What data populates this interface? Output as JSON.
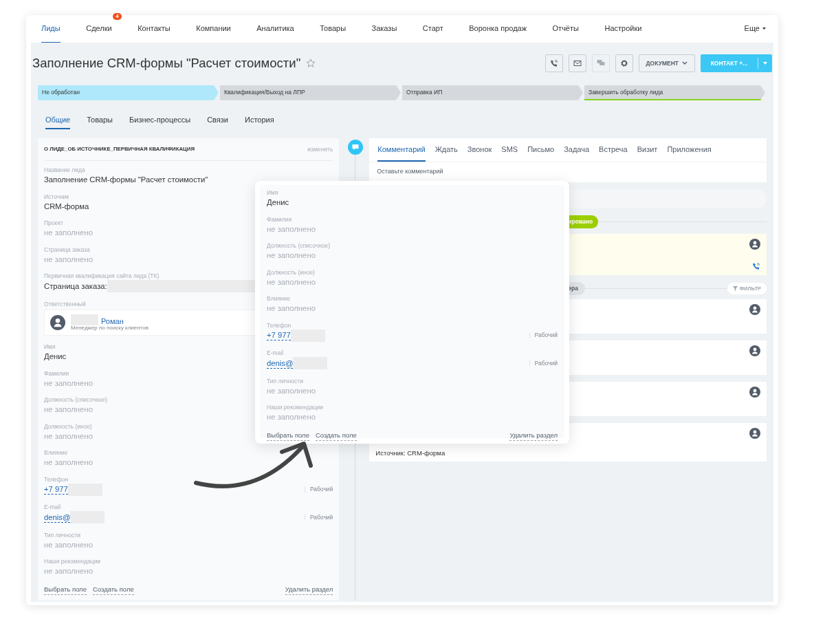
{
  "nav": {
    "items": [
      {
        "label": "Лиды",
        "selected": true
      },
      {
        "label": "Сделки",
        "selected": false,
        "badge": "4"
      },
      {
        "label": "Контакты",
        "selected": false
      },
      {
        "label": "Компании",
        "selected": false
      },
      {
        "label": "Аналитика",
        "selected": false
      },
      {
        "label": "Товары",
        "selected": false
      },
      {
        "label": "Заказы",
        "selected": false
      },
      {
        "label": "Старт",
        "selected": false
      },
      {
        "label": "Воронка продаж",
        "selected": false
      },
      {
        "label": "Отчёты",
        "selected": false
      },
      {
        "label": "Настройки",
        "selected": false
      }
    ],
    "more": "Еще"
  },
  "header": {
    "title": "Заполнение CRM-формы \"Расчет стоимости\"",
    "starred": false,
    "icon_buttons": [
      {
        "kind": "phone",
        "disabled": false
      },
      {
        "kind": "mail",
        "disabled": false
      },
      {
        "kind": "chat",
        "disabled": true
      },
      {
        "kind": "settings",
        "disabled": false
      }
    ],
    "document_button": "ДОКУМЕНТ",
    "primary_button": "КОНТАКТ +..."
  },
  "stages": [
    {
      "label": "Не обработан",
      "selected": true,
      "kind": "step"
    },
    {
      "label": "Квалификация/Выход на ЛПР",
      "selected": false,
      "kind": "step"
    },
    {
      "label": "Отправка ИП",
      "selected": false,
      "kind": "step"
    },
    {
      "label": "Завершить обработку лида",
      "selected": false,
      "kind": "final"
    }
  ],
  "tabs": [
    {
      "label": "Общие",
      "selected": true
    },
    {
      "label": "Товары",
      "selected": false
    },
    {
      "label": "Бизнес-процессы",
      "selected": false
    },
    {
      "label": "Связи",
      "selected": false
    },
    {
      "label": "История",
      "selected": false
    }
  ],
  "section": {
    "title": "О ЛИДЕ_ОБ ИСТОЧНИКЕ_ПЕРВИЧНАЯ КВАЛИФИКАЦИЯ",
    "edit_link": "изменить",
    "fields": [
      {
        "kind": "text",
        "label": "Название лида",
        "value": "Заполнение CRM-формы \"Расчет стоимости\""
      },
      {
        "kind": "text",
        "label": "Источник",
        "value": "CRM-форма"
      },
      {
        "kind": "empty",
        "label": "Проект",
        "value": "не заполнено"
      },
      {
        "kind": "empty",
        "label": "Страница заказа",
        "value": "не заполнено"
      },
      {
        "kind": "masked",
        "label": "Первичная квалификация сайта лида (ТК)",
        "value": "Страница заказа:"
      },
      {
        "kind": "person",
        "label": "Ответственный",
        "value": "Роман",
        "role": "Менеджер по поиску клиентов"
      },
      {
        "kind": "text",
        "label": "Имя",
        "value": "Денис"
      },
      {
        "kind": "empty",
        "label": "Фамилия",
        "value": "не заполнено"
      },
      {
        "kind": "empty",
        "label": "Должность (списочное)",
        "value": "не заполнено"
      },
      {
        "kind": "empty",
        "label": "Должность (иное)",
        "value": "не заполнено"
      },
      {
        "kind": "empty",
        "label": "Влияние",
        "value": "не заполнено"
      },
      {
        "kind": "contact",
        "label": "Телефон",
        "value": "+7 977",
        "type": "Рабочий"
      },
      {
        "kind": "contact",
        "label": "E-mail",
        "value": "denis@",
        "type": "Рабочий"
      },
      {
        "kind": "empty",
        "label": "Тип личности",
        "value": "не заполнено"
      },
      {
        "kind": "empty",
        "label": "Наши рекомендации",
        "value": "не заполнено"
      }
    ],
    "footer_links": [
      "Выбрать поле",
      "Создать поле"
    ],
    "delete_link": "Удалить раздел"
  },
  "activity": {
    "tabs": [
      {
        "label": "Комментарий",
        "selected": true
      },
      {
        "label": "Ждать",
        "selected": false
      },
      {
        "label": "Звонок",
        "selected": false
      },
      {
        "label": "SMS",
        "selected": false
      },
      {
        "label": "Письмо",
        "selected": false
      },
      {
        "label": "Задача",
        "selected": false
      },
      {
        "label": "Встреча",
        "selected": false
      },
      {
        "label": "Визит",
        "selected": false
      },
      {
        "label": "Приложения",
        "selected": false
      }
    ],
    "placeholder": "Оставьте комментарий"
  },
  "timeline": {
    "status_badge": "ировано",
    "filter_pill": "ера",
    "filter_button": "ФИЛЬТР",
    "entries": [
      {
        "kind": "planned"
      },
      {
        "kind": "event"
      },
      {
        "kind": "event"
      },
      {
        "kind": "event"
      },
      {
        "kind": "event",
        "lines": [
          "Источник: CRM-форма"
        ]
      }
    ]
  },
  "popup": {
    "fields": [
      {
        "kind": "text",
        "label": "Имя",
        "value": "Денис"
      },
      {
        "kind": "empty",
        "label": "Фамилия",
        "value": "не заполнено"
      },
      {
        "kind": "empty",
        "label": "Должность (списочное)",
        "value": "не заполнено"
      },
      {
        "kind": "empty",
        "label": "Должность (иное)",
        "value": "не заполнено"
      },
      {
        "kind": "empty",
        "label": "Влияние",
        "value": "не заполнено"
      },
      {
        "kind": "contact",
        "label": "Телефон",
        "value": "+7 977",
        "type": "Рабочий"
      },
      {
        "kind": "contact",
        "label": "E-mail",
        "value": "denis@",
        "type": "Рабочий"
      },
      {
        "kind": "empty",
        "label": "Тип личности",
        "value": "не заполнено"
      },
      {
        "kind": "empty",
        "label": "Наши рекомендации",
        "value": "не заполнено"
      }
    ],
    "footer_links": [
      "Выбрать поле",
      "Создать поле"
    ],
    "delete_link": "Удалить раздел"
  }
}
